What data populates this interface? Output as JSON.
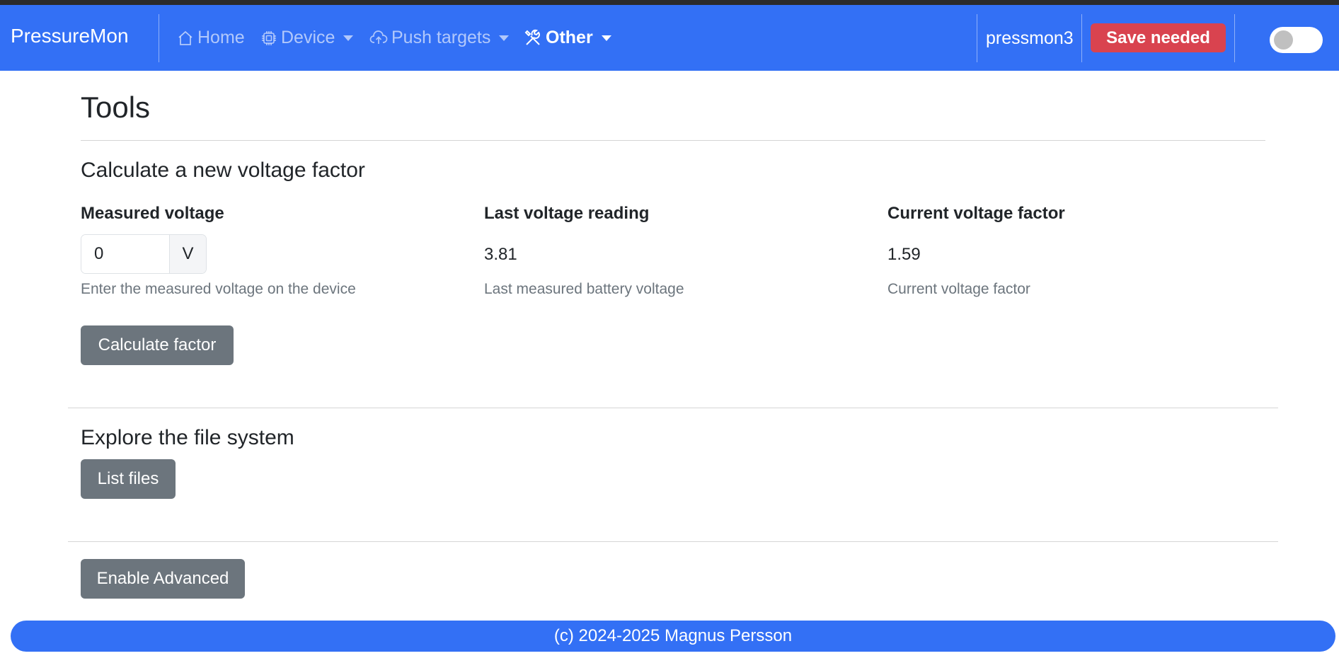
{
  "navbar": {
    "brand": "PressureMon",
    "items": [
      {
        "label": "Home",
        "icon": "house-icon",
        "dropdown": false
      },
      {
        "label": "Device",
        "icon": "cpu-icon",
        "dropdown": true
      },
      {
        "label": "Push targets",
        "icon": "cloud-upload-icon",
        "dropdown": true
      },
      {
        "label": "Other",
        "icon": "tools-icon",
        "dropdown": true,
        "active": true
      }
    ],
    "hostname": "pressmon3",
    "save_label": "Save needed",
    "theme_toggle_on": false
  },
  "page": {
    "title": "Tools",
    "voltage_section": {
      "title": "Calculate a new voltage factor",
      "measured": {
        "label": "Measured voltage",
        "value": "0",
        "unit": "V",
        "help": "Enter the measured voltage on the device"
      },
      "last_reading": {
        "label": "Last voltage reading",
        "value": "3.81",
        "help": "Last measured battery voltage"
      },
      "current_factor": {
        "label": "Current voltage factor",
        "value": "1.59",
        "help": "Current voltage factor"
      },
      "button_label": "Calculate factor"
    },
    "files_section": {
      "title": "Explore the file system",
      "button_label": "List files"
    },
    "advanced_button_label": "Enable Advanced"
  },
  "footer": {
    "text": "(c) 2024-2025 Magnus Persson"
  },
  "colors": {
    "primary": "#3370f5",
    "danger": "#d9434f",
    "secondary": "#6c757d"
  }
}
